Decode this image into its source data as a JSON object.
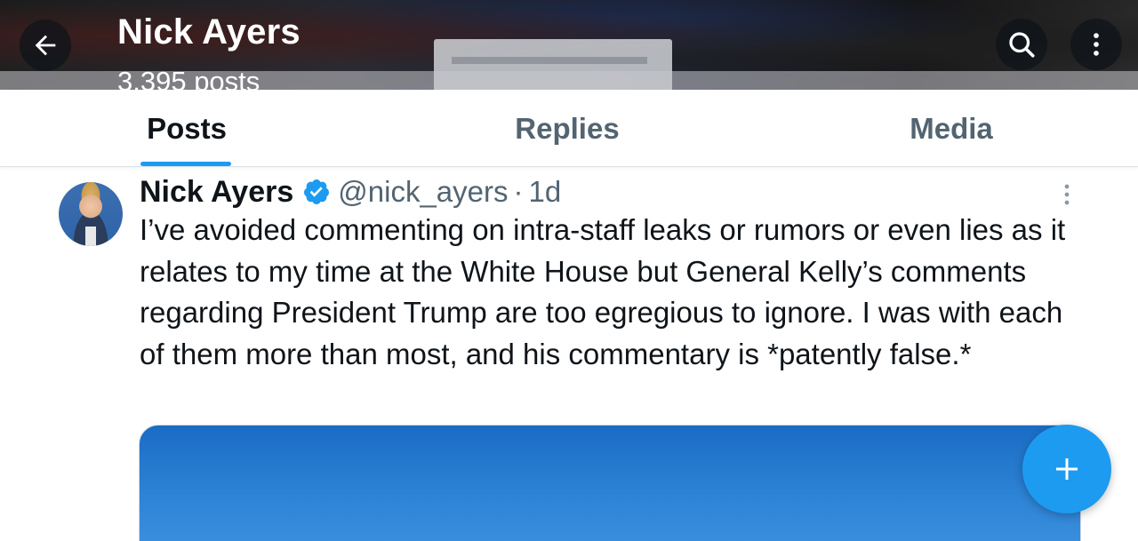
{
  "header": {
    "name": "Nick Ayers",
    "post_count": "3,395 posts",
    "back_icon": "arrow-left-icon",
    "search_icon": "search-icon",
    "more_icon": "more-vertical-icon"
  },
  "tabs": [
    {
      "label": "Posts",
      "active": true
    },
    {
      "label": "Replies",
      "active": false
    },
    {
      "label": "Media",
      "active": false
    }
  ],
  "post": {
    "author_name": "Nick Ayers",
    "verified": true,
    "handle": "@nick_ayers",
    "separator": "·",
    "time": "1d",
    "text": "I’ve avoided commenting on intra-staff leaks or rumors or even lies as it relates to my time at the White House but General Kelly’s comments regarding President Trump are too egregious to ignore. I was with each of them more than most, and his commentary is *patently false.*"
  },
  "colors": {
    "accent": "#1d9bf0",
    "text_primary": "#0f1419",
    "text_secondary": "#536471"
  },
  "fab_icon": "plus-icon"
}
